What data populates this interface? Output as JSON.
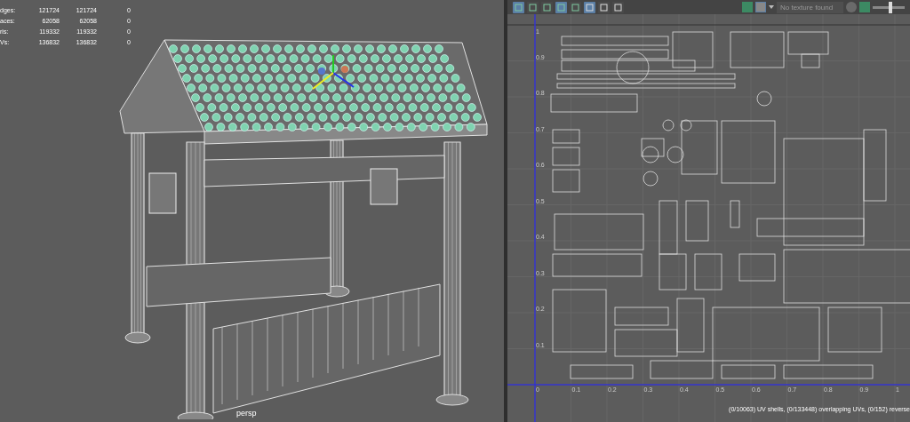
{
  "viewport": {
    "hud_stats": [
      {
        "label": "dges:",
        "value_1": "121724",
        "value_2": "121724",
        "value_3": "0"
      },
      {
        "label": "aces:",
        "value_1": "62058",
        "value_2": "62058",
        "value_3": "0"
      },
      {
        "label": "ris:",
        "value_1": "119332",
        "value_2": "119332",
        "value_3": "0"
      },
      {
        "label": "Vs:",
        "value_1": "136832",
        "value_2": "136832",
        "value_3": "0"
      }
    ],
    "camera_label": "persp"
  },
  "uv_editor": {
    "toolbar": {
      "texture_field": "No texture found",
      "slider": {
        "level": 0.55
      }
    },
    "v_labels": [
      "1",
      "0.9",
      "0.8",
      "0.7",
      "0.6",
      "0.5",
      "0.4",
      "0.3",
      "0.2",
      "0.1"
    ],
    "u_labels": [
      "0",
      "0.1",
      "0.2",
      "0.3",
      "0.4",
      "0.5",
      "0.6",
      "0.7",
      "0.8",
      "0.9",
      "1"
    ],
    "status": "(0/10063) UV shells, (0/133448) overlapping UVs, (0/152) reverse"
  }
}
